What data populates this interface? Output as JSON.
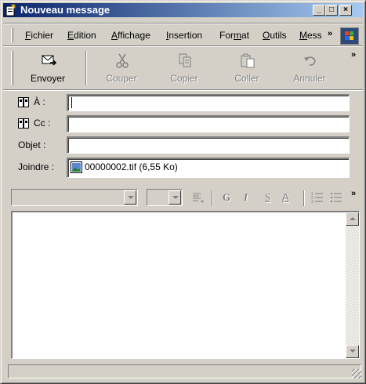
{
  "window": {
    "title": "Nouveau message"
  },
  "caption": {
    "minimize": "_",
    "maximize": "□",
    "close": "×"
  },
  "menu": {
    "items": [
      {
        "label": "Fichier",
        "ul": "F"
      },
      {
        "label": "Edition",
        "ul": "E"
      },
      {
        "label": "Affichage",
        "ul": "A"
      },
      {
        "label": "Insertion",
        "ul": "I"
      },
      {
        "label": "Format",
        "ul": "m"
      },
      {
        "label": "Outils",
        "ul": "O"
      },
      {
        "label": "Mess",
        "ul": "M"
      }
    ],
    "more": "»"
  },
  "toolbar": {
    "send": "Envoyer",
    "cut": "Couper",
    "copy": "Copier",
    "paste": "Coller",
    "undo": "Annuler",
    "more": "»"
  },
  "fields": {
    "to_label": "À :",
    "cc_label": "Cc :",
    "subject_label": "Objet :",
    "attach_label": "Joindre :",
    "to_value": "",
    "cc_value": "",
    "subject_value": "",
    "attachment": "00000002.tif (6,55 Ko)"
  },
  "format": {
    "bold": "G",
    "italic": "I",
    "underline": "S",
    "fontcolor": "A",
    "more": "»"
  },
  "message_body": ""
}
